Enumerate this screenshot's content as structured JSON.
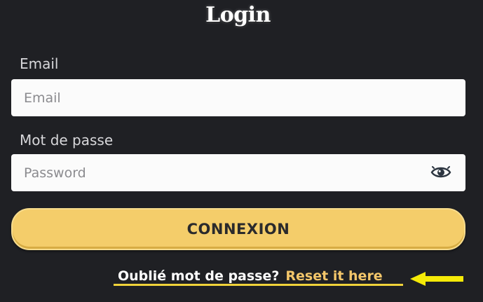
{
  "title": "Login",
  "email": {
    "label": "Email",
    "placeholder": "Email",
    "value": ""
  },
  "password": {
    "label": "Mot de passe",
    "placeholder": "Password",
    "value": "",
    "toggle_icon": "eye-icon"
  },
  "submit": {
    "label": "CONNEXION"
  },
  "forgot": {
    "text": "Oublié mot de passe?",
    "link_label": "Reset it here",
    "pointer_icon": "arrow-left-icon"
  },
  "colors": {
    "background": "#1f2024",
    "button": "#f4cd6a",
    "link": "#f3c66a",
    "highlight": "#f0d23a",
    "arrow": "#f5ea07"
  }
}
